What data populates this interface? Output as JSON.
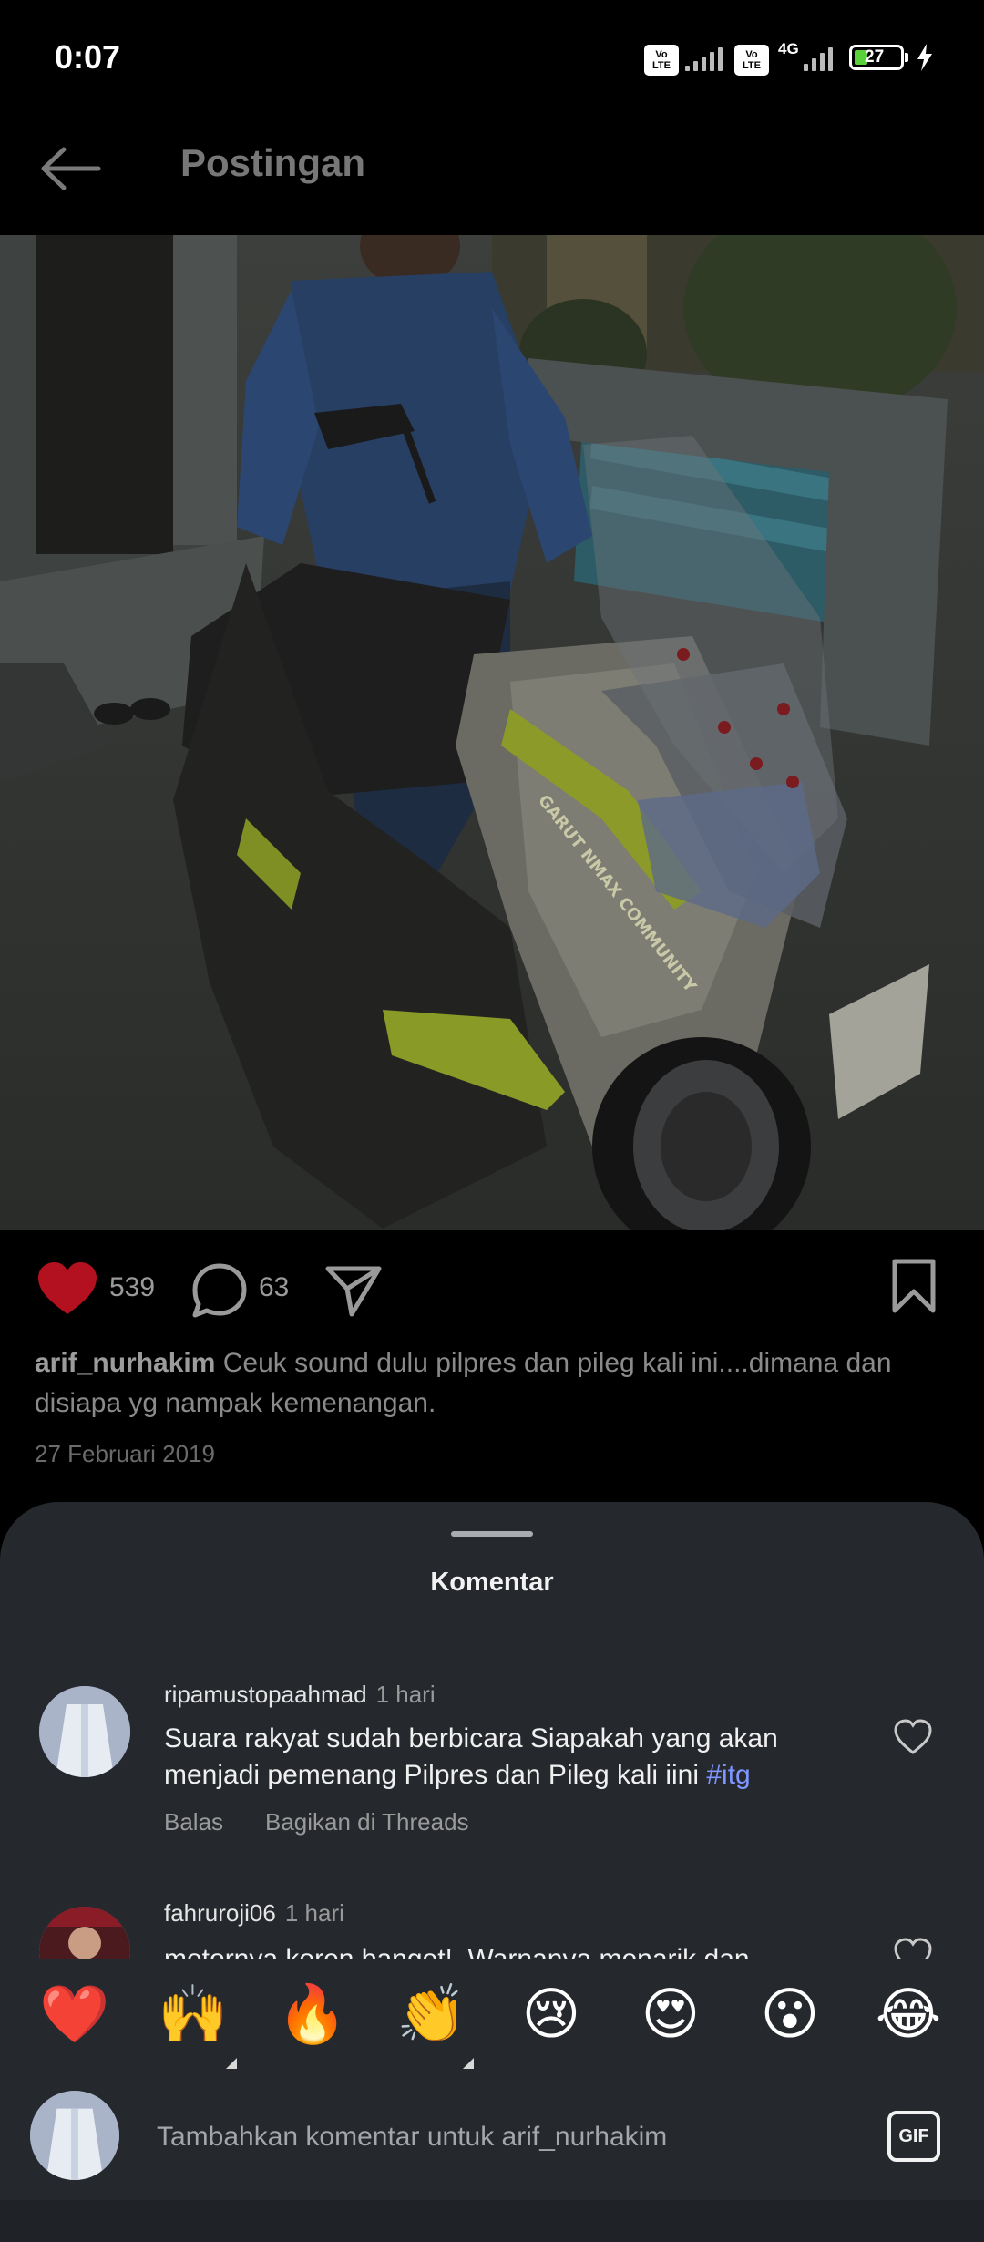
{
  "status_bar": {
    "time": "0:07",
    "sim1_badge": "Vo LTE",
    "sim2_badge": "Vo LTE",
    "network_type": "4G",
    "battery_level": "27",
    "charging": true
  },
  "header": {
    "title": "Postingan",
    "back_icon": "arrow-left-icon"
  },
  "post": {
    "likes": "539",
    "comments_count": "63",
    "liked": true,
    "caption_user": "arif_nurhakim",
    "caption_text": "Ceuk sound dulu pilpres dan pileg kali ini....dimana dan disiapa yg nampak kemenangan.",
    "date": "27 Februari 2019",
    "photo_text": "GARUT NMAX COMMUNITY"
  },
  "comments_sheet": {
    "title": "Komentar",
    "comments": [
      {
        "username": "ripamustopaahmad",
        "time": "1 hari",
        "text_line1": "Suara rakyat sudah berbicara Siapakah yang akan",
        "text_line2": "menjadi pemenang Pilpres dan Pileg kali iini",
        "hashtag": "#itg",
        "reply_label": "Balas",
        "share_label": "Bagikan di Threads"
      },
      {
        "username": "fahruroji06",
        "time": "1 hari",
        "text_line1": "motornya keren banget!. Warnanya menarik dan"
      }
    ]
  },
  "emoji_bar": [
    "❤️",
    "🙌",
    "🔥",
    "👏",
    "😢",
    "😍",
    "😮",
    "😂"
  ],
  "composer": {
    "placeholder": "Tambahkan komentar untuk arif_nurhakim",
    "gif_label": "GIF"
  },
  "colors": {
    "background": "#000000",
    "sheet": "#25282d",
    "like_red": "#b3111f",
    "hashtag": "#7f95ff"
  }
}
